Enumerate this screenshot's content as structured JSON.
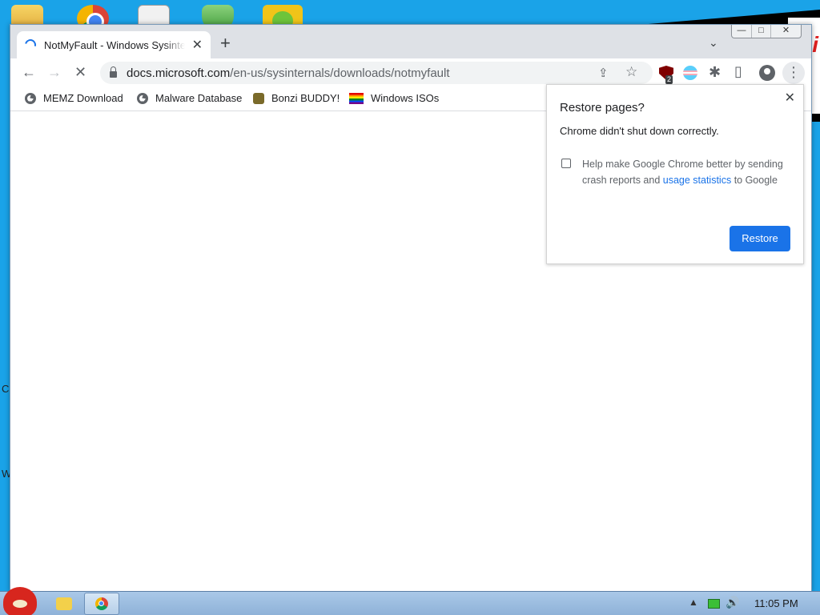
{
  "desktop": {
    "icons": [
      "folder-icon",
      "chrome-icon",
      "solitaire-icon",
      "shield-icon",
      "angry-birds-icon"
    ],
    "scribble_text": "i",
    "left_edge_texts": [
      "C",
      "W"
    ]
  },
  "browser": {
    "tab": {
      "title": "NotMyFault - Windows Sysinternals",
      "close": "✕"
    },
    "new_tab": "+",
    "tab_search": "⌄",
    "window_controls": {
      "minimize": "—",
      "maximize": "□",
      "close": "✕"
    },
    "toolbar": {
      "back": "←",
      "forward": "→",
      "stop": "✕",
      "url_host": "docs.microsoft.com",
      "url_path": "/en-us/sysinternals/downloads/notmyfault",
      "share": "⇪",
      "bookmark_star": "☆",
      "ublock_badge": "2",
      "extensions": "✱",
      "side_panel": "▯",
      "menu": "⋮"
    },
    "bookmarks": [
      {
        "label": "MEMZ Download",
        "icon": "globe-icon"
      },
      {
        "label": "Malware Database",
        "icon": "globe-icon"
      },
      {
        "label": "Bonzi BUDDY!",
        "icon": "bonzi-icon"
      },
      {
        "label": "Windows ISOs",
        "icon": "rainbow-flag-icon"
      }
    ]
  },
  "restore_popup": {
    "title": "Restore pages?",
    "message": "Chrome didn't shut down correctly.",
    "checkbox_text_before": "Help make Google Chrome better by sending crash reports and ",
    "checkbox_link": "usage statistics",
    "checkbox_text_after": " to Google",
    "checkbox_checked": false,
    "button_label": "Restore",
    "close": "✕"
  },
  "taskbar": {
    "tray_arrow": "▲",
    "volume": "🔊",
    "clock": "11:05 PM"
  },
  "colors": {
    "accent": "#1a73e8",
    "desktop": "#1aa3e8",
    "tabstrip": "#dee1e6"
  }
}
